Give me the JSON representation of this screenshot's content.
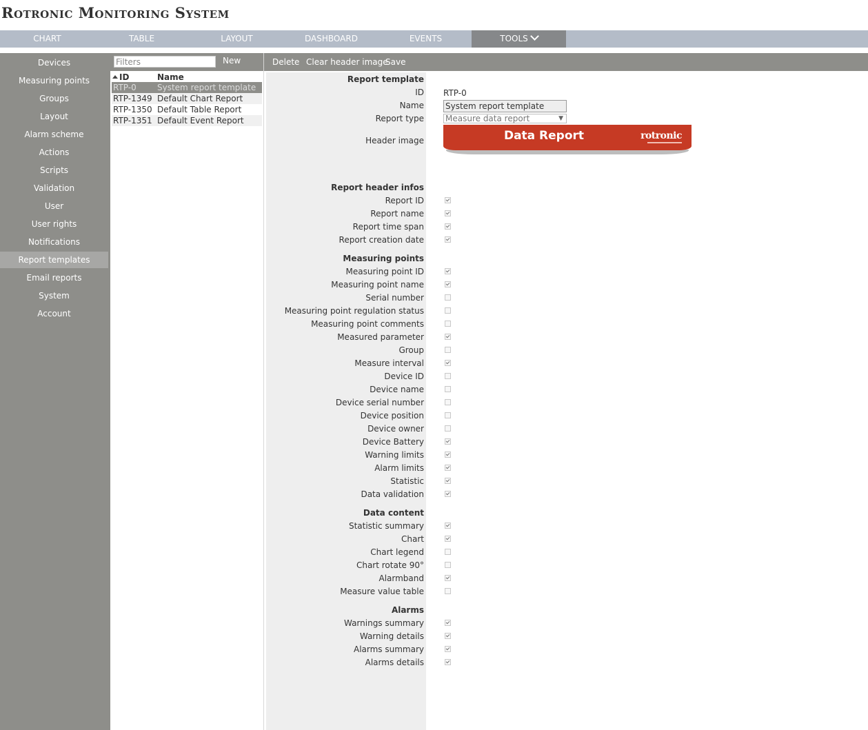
{
  "app": {
    "title": "Rotronic Monitoring System"
  },
  "topnav": {
    "tabs": [
      "CHART",
      "TABLE",
      "LAYOUT",
      "DASHBOARD",
      "EVENTS",
      "TOOLS"
    ],
    "active": "TOOLS"
  },
  "sidebar": {
    "items": [
      "Devices",
      "Measuring points",
      "Groups",
      "Layout",
      "Alarm scheme",
      "Actions",
      "Scripts",
      "Validation",
      "User",
      "User rights",
      "Notifications",
      "Report templates",
      "Email reports",
      "System",
      "Account"
    ],
    "active": "Report templates"
  },
  "list": {
    "filter_placeholder": "Filters",
    "new_label": "New",
    "col_id": "ID",
    "col_name": "Name",
    "rows": [
      {
        "id": "RTP-0",
        "name": "System report template"
      },
      {
        "id": "RTP-1349",
        "name": "Default Chart Report"
      },
      {
        "id": "RTP-1350",
        "name": "Default Table Report"
      },
      {
        "id": "RTP-1351",
        "name": "Default Event Report"
      }
    ]
  },
  "toolbar": {
    "delete": "Delete",
    "clear_header": "Clear header image",
    "save": "Save"
  },
  "form": {
    "section_template": "Report template",
    "id_label": "ID",
    "id_value": "RTP-0",
    "name_label": "Name",
    "name_value": "System report template",
    "type_label": "Report type",
    "type_value": "Measure data report",
    "header_image_label": "Header image",
    "header_image": {
      "title": "Data Report",
      "logo": "rotronic"
    },
    "sections": [
      {
        "title": "Report header infos",
        "items": [
          {
            "label": "Report ID",
            "checked": true
          },
          {
            "label": "Report name",
            "checked": true
          },
          {
            "label": "Report time span",
            "checked": true
          },
          {
            "label": "Report creation date",
            "checked": true
          }
        ]
      },
      {
        "title": "Measuring points",
        "items": [
          {
            "label": "Measuring point ID",
            "checked": true
          },
          {
            "label": "Measuring point name",
            "checked": true
          },
          {
            "label": "Serial number",
            "checked": false
          },
          {
            "label": "Measuring point regulation status",
            "checked": false
          },
          {
            "label": "Measuring point comments",
            "checked": false
          },
          {
            "label": "Measured parameter",
            "checked": true
          },
          {
            "label": "Group",
            "checked": false
          },
          {
            "label": "Measure interval",
            "checked": true
          },
          {
            "label": "Device ID",
            "checked": false
          },
          {
            "label": "Device name",
            "checked": false
          },
          {
            "label": "Device serial number",
            "checked": false
          },
          {
            "label": "Device position",
            "checked": false
          },
          {
            "label": "Device owner",
            "checked": false
          },
          {
            "label": "Device Battery",
            "checked": true
          },
          {
            "label": "Warning limits",
            "checked": true
          },
          {
            "label": "Alarm limits",
            "checked": true
          },
          {
            "label": "Statistic",
            "checked": true
          },
          {
            "label": "Data validation",
            "checked": true
          }
        ]
      },
      {
        "title": "Data content",
        "items": [
          {
            "label": "Statistic summary",
            "checked": true
          },
          {
            "label": "Chart",
            "checked": true
          },
          {
            "label": "Chart legend",
            "checked": false
          },
          {
            "label": "Chart rotate 90°",
            "checked": false
          },
          {
            "label": "Alarmband",
            "checked": true
          },
          {
            "label": "Measure value table",
            "checked": false
          }
        ]
      },
      {
        "title": "Alarms",
        "items": [
          {
            "label": "Warnings summary",
            "checked": true
          },
          {
            "label": "Warning details",
            "checked": true
          },
          {
            "label": "Alarms summary",
            "checked": true
          },
          {
            "label": "Alarms details",
            "checked": true
          }
        ]
      }
    ]
  }
}
